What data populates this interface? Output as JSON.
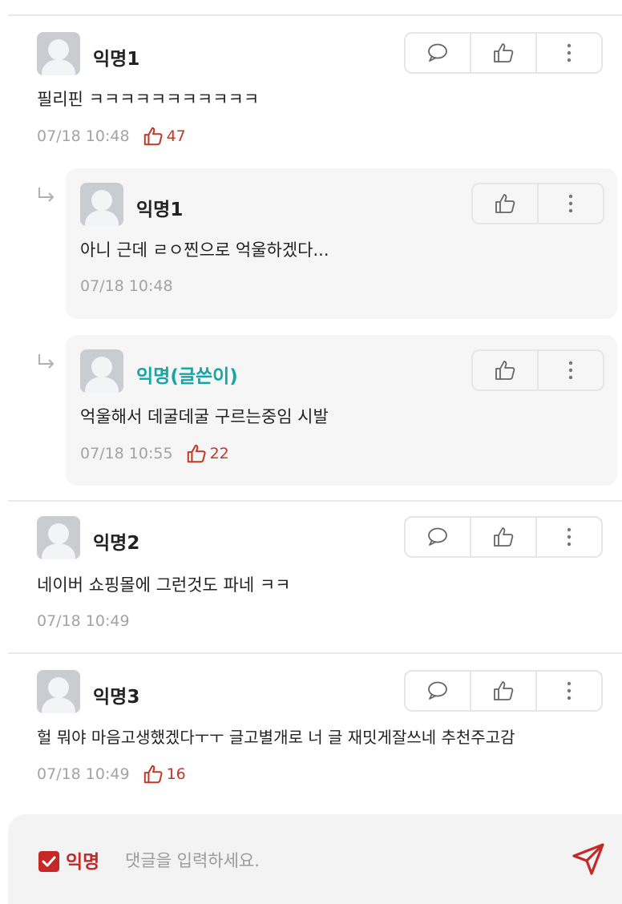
{
  "comments": [
    {
      "name": "익명1",
      "text": "필리핀 ㅋㅋㅋㅋㅋㅋㅋㅋㅋㅋㅋ",
      "time": "07/18 10:48",
      "likes": "47"
    },
    {
      "name": "익명2",
      "text": "네이버 쇼핑몰에 그런것도 파네 ㅋㅋ",
      "time": "07/18 10:49",
      "likes": ""
    },
    {
      "name": "익명3",
      "text": "헐 뭐야 마음고생했겠다ㅜㅜ 글고별개로 너 글 재밋게잘쓰네 추천주고감",
      "time": "07/18 10:49",
      "likes": "16"
    }
  ],
  "replies": [
    {
      "name": "익명1",
      "text": "아니 근데 ㄹㅇ찐으로 억울하겠다...",
      "time": "07/18 10:48",
      "likes": ""
    },
    {
      "name": "익명(글쓴이)",
      "text": "억울해서 데굴데굴 구르는중임 시발",
      "time": "07/18 10:55",
      "likes": "22"
    }
  ],
  "input": {
    "anonymous_label": "익명",
    "anonymous_checked": true,
    "placeholder": "댓글을 입력하세요."
  },
  "icons": {
    "comment": "speech-bubble-icon",
    "like": "thumbs-up-icon",
    "more": "more-vertical-icon",
    "send": "send-icon",
    "reply": "reply-arrow-icon"
  },
  "colors": {
    "like_red": "#c0392b",
    "op_teal": "#14a6a6",
    "check_red": "#c62828"
  }
}
